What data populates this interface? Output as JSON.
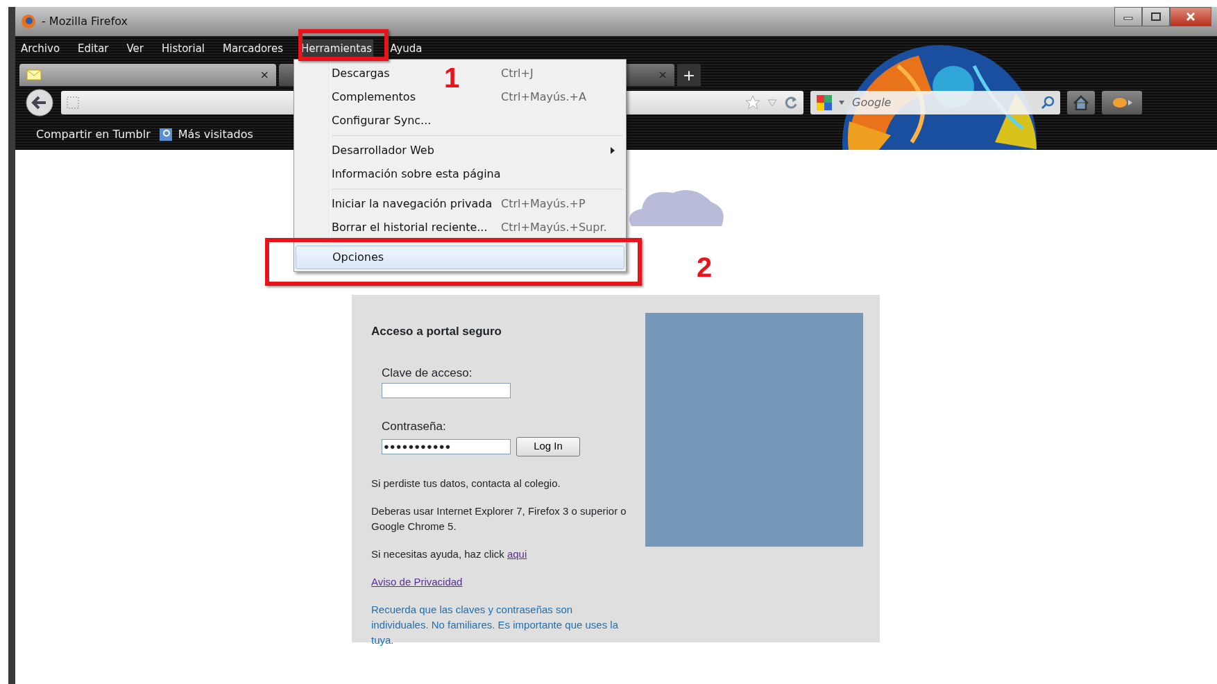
{
  "window": {
    "title": "- Mozilla Firefox"
  },
  "menu_bar": [
    {
      "label": "Archivo",
      "selected": false
    },
    {
      "label": "Editar",
      "selected": false
    },
    {
      "label": "Ver",
      "selected": false
    },
    {
      "label": "Historial",
      "selected": false
    },
    {
      "label": "Marcadores",
      "selected": false
    },
    {
      "label": "Herramientas",
      "selected": true
    },
    {
      "label": "Ayuda",
      "selected": false
    }
  ],
  "tabs": [
    {
      "close": "×",
      "selected": true
    },
    {
      "close": "×",
      "selected": false
    }
  ],
  "new_tab": "+",
  "search": {
    "placeholder": "Google"
  },
  "bookmarks": [
    "Compartir en Tumblr",
    "Más visitados"
  ],
  "dropdown": [
    {
      "kind": "item",
      "label": "Descargas",
      "shortcut": "Ctrl+J",
      "submenu": false,
      "selected": false
    },
    {
      "kind": "item",
      "label": "Complementos",
      "shortcut": "Ctrl+Mayús.+A",
      "submenu": false,
      "selected": false
    },
    {
      "kind": "item",
      "label": "Configurar Sync...",
      "submenu": false,
      "selected": false
    },
    {
      "kind": "separator"
    },
    {
      "kind": "item",
      "label": "Desarrollador Web",
      "submenu": true,
      "selected": false
    },
    {
      "kind": "item",
      "label": "Información sobre esta página",
      "submenu": false,
      "selected": false
    },
    {
      "kind": "separator"
    },
    {
      "kind": "item",
      "label": "Iniciar la navegación privada",
      "shortcut": "Ctrl+Mayús.+P",
      "submenu": false,
      "selected": false
    },
    {
      "kind": "item",
      "label": "Borrar el historial reciente...",
      "shortcut": "Ctrl+Mayús.+Supr.",
      "submenu": false,
      "selected": false
    },
    {
      "kind": "separator"
    },
    {
      "kind": "item",
      "label": "Opciones",
      "submenu": false,
      "selected": true
    }
  ],
  "annotations": [
    {
      "label": "1"
    },
    {
      "label": "2"
    }
  ],
  "login": {
    "title": "Acceso a portal seguro",
    "fields": [
      {
        "label": "Clave de acceso:"
      },
      {
        "label": "Contraseña:",
        "value": "●●●●●●●●●●●"
      }
    ],
    "button": "Log In",
    "paragraphs": [
      {
        "kind": "text",
        "text": "Si perdiste tus datos, contacta al colegio."
      },
      {
        "kind": "text",
        "text": "Deberas usar Internet Explorer 7, Firefox 3 o superior o Google Chrome 5."
      },
      {
        "kind": "text",
        "text": "Si necesitas ayuda, haz click ",
        "link": "aqui"
      },
      {
        "kind": "link",
        "text": "Aviso de Privacidad"
      },
      {
        "kind": "notice",
        "text": "Recuerda que las claves y contraseñas son individuales. No familiares. Es importante que uses la tuya."
      }
    ]
  }
}
